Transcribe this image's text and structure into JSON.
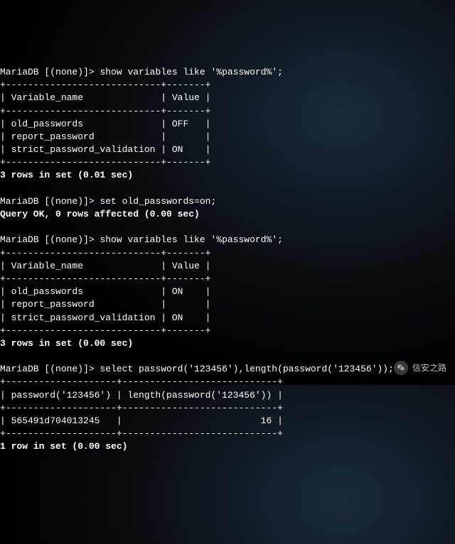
{
  "prompt1": {
    "ps": "MariaDB [(none)]> ",
    "cmd": "show variables like '%password%';"
  },
  "table1": {
    "border_top": "+----------------------------+-------+",
    "header": "| Variable_name              | Value |",
    "border_mid": "+----------------------------+-------+",
    "row1": "| old_passwords              | OFF   |",
    "row2": "| report_password            |       |",
    "row3": "| strict_password_validation | ON    |",
    "border_bot": "+----------------------------+-------+"
  },
  "result1": "3 rows in set (0.01 sec)",
  "prompt2": {
    "ps": "MariaDB [(none)]> ",
    "cmd": "set old_passwords=on;"
  },
  "result2": "Query OK, 0 rows affected (0.00 sec)",
  "prompt3": {
    "ps": "MariaDB [(none)]> ",
    "cmd": "show variables like '%password%';"
  },
  "table2": {
    "border_top": "+----------------------------+-------+",
    "header": "| Variable_name              | Value |",
    "border_mid": "+----------------------------+-------+",
    "row1": "| old_passwords              | ON    |",
    "row2": "| report_password            |       |",
    "row3": "| strict_password_validation | ON    |",
    "border_bot": "+----------------------------+-------+"
  },
  "result3": "3 rows in set (0.00 sec)",
  "prompt4": {
    "ps": "MariaDB [(none)]> ",
    "cmd": "select password('123456'),length(password('123456'));"
  },
  "table3": {
    "border_top": "+--------------------+----------------------------+",
    "header": "| password('123456') | length(password('123456')) |",
    "border_mid": "+--------------------+----------------------------+",
    "row1": "| 565491d704013245   |                         16 |",
    "border_bot": "+--------------------+----------------------------+"
  },
  "result4": "1 row in set (0.00 sec)",
  "watermark": "信安之路"
}
